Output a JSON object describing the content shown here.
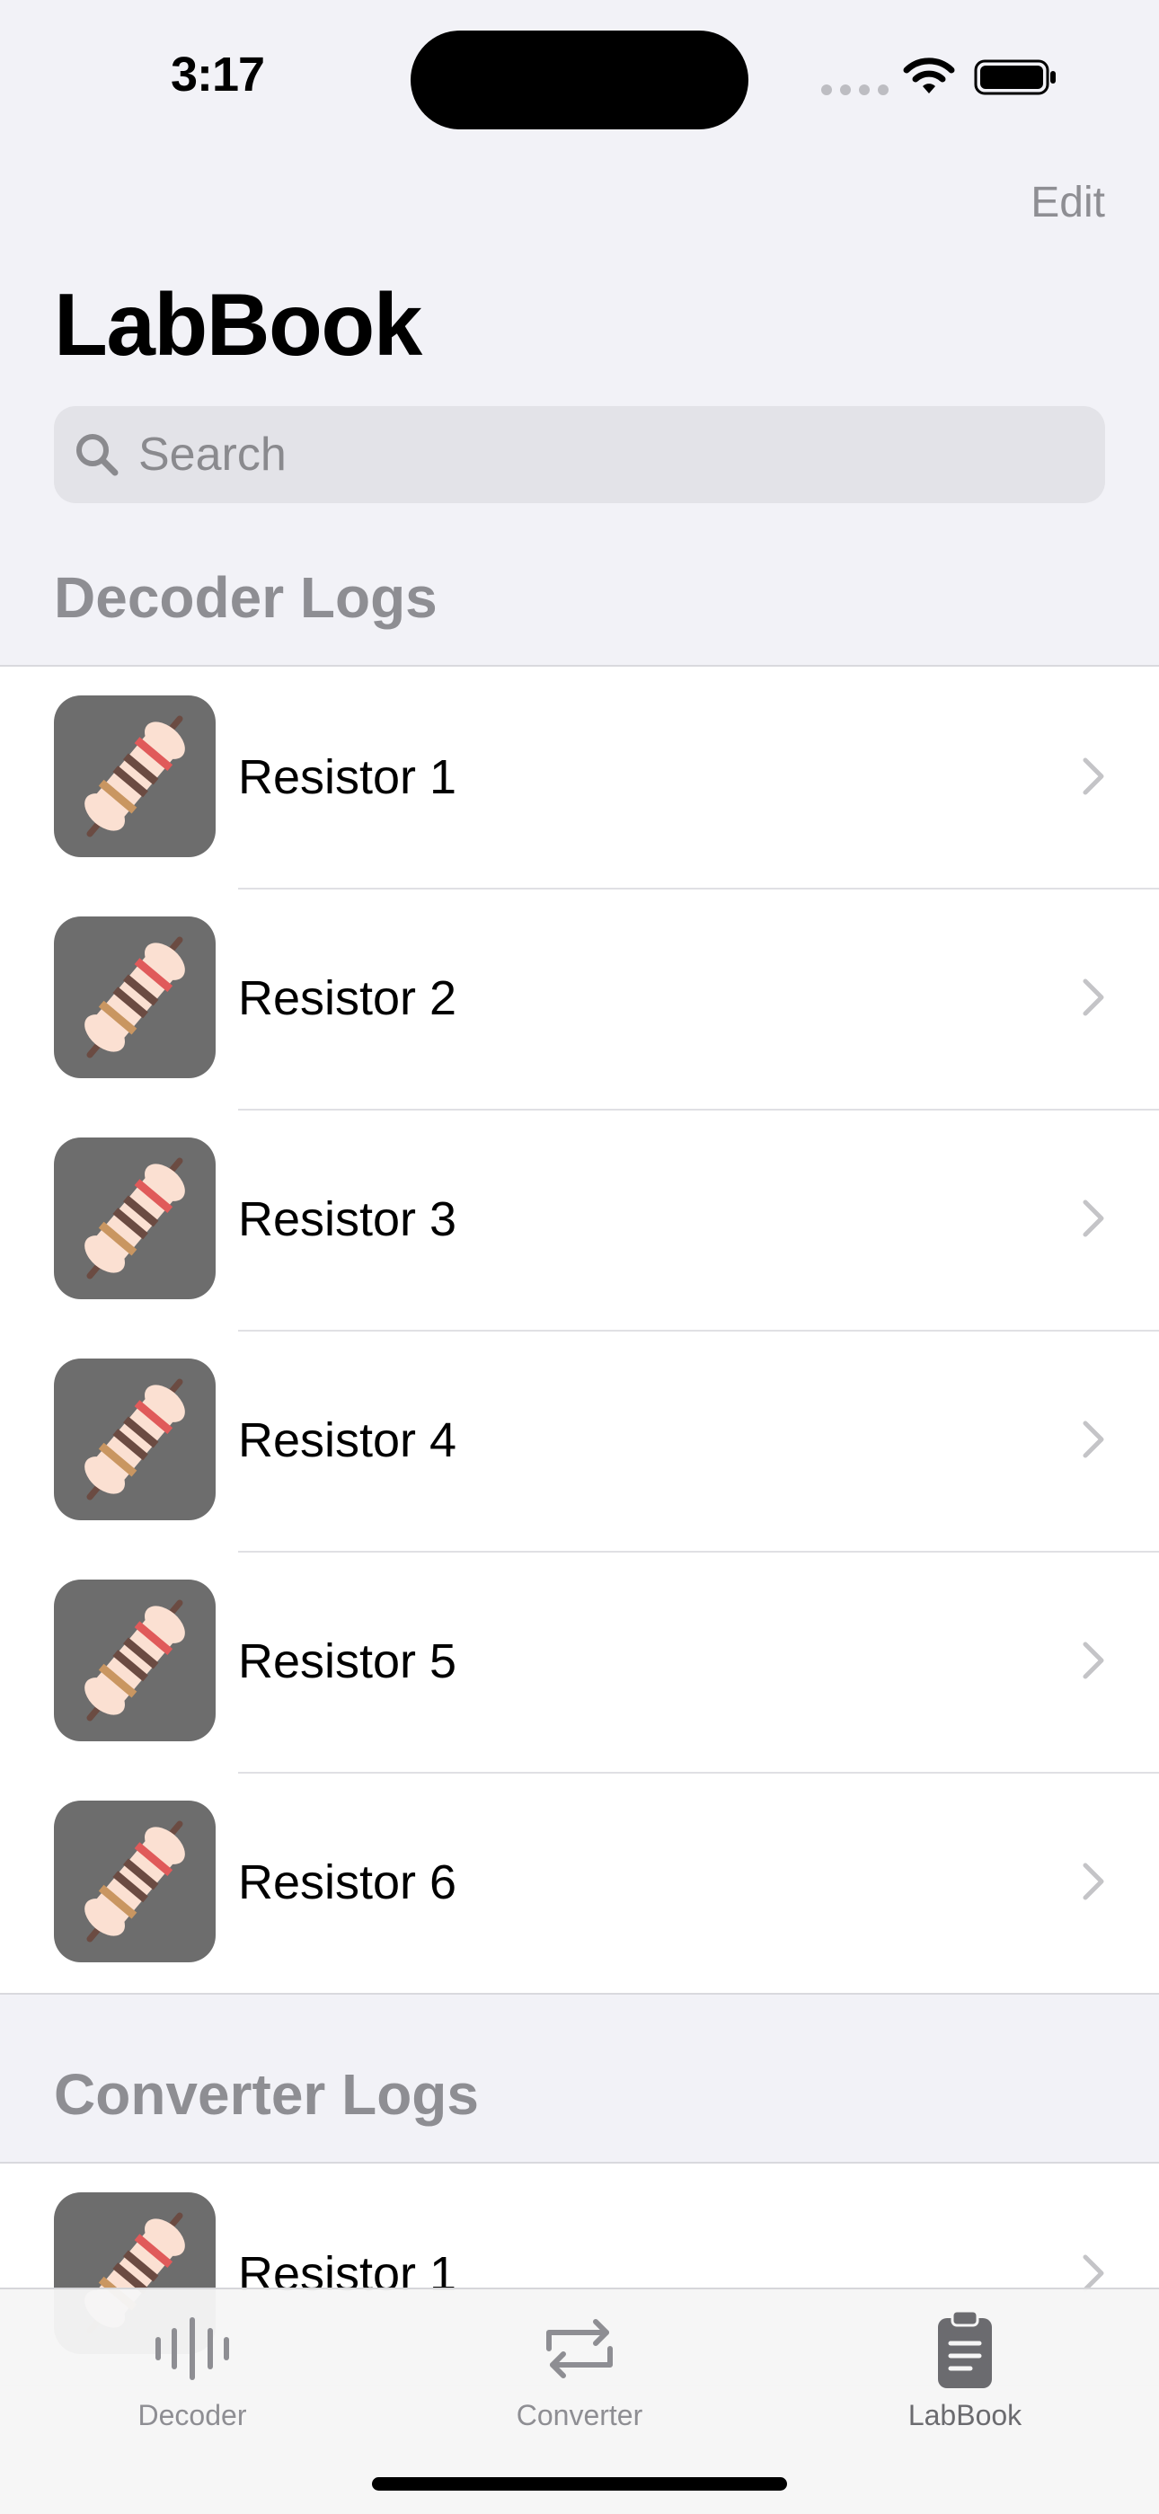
{
  "status_bar": {
    "time": "3:17"
  },
  "nav": {
    "edit_label": "Edit",
    "title": "LabBook"
  },
  "search": {
    "placeholder": "Search",
    "value": ""
  },
  "sections": {
    "decoder": {
      "header": "Decoder Logs",
      "items": [
        {
          "label": "Resistor 1",
          "icon": "resistor-icon"
        },
        {
          "label": "Resistor 2",
          "icon": "resistor-icon"
        },
        {
          "label": "Resistor 3",
          "icon": "resistor-icon"
        },
        {
          "label": "Resistor 4",
          "icon": "resistor-icon"
        },
        {
          "label": "Resistor 5",
          "icon": "resistor-icon"
        },
        {
          "label": "Resistor 6",
          "icon": "resistor-icon"
        }
      ]
    },
    "converter": {
      "header": "Converter Logs",
      "items": [
        {
          "label": "Resistor 1",
          "icon": "resistor-icon"
        }
      ]
    }
  },
  "tab_bar": {
    "tabs": [
      {
        "label": "Decoder",
        "icon": "waveform-icon",
        "active": false
      },
      {
        "label": "Converter",
        "icon": "convert-arrows-icon",
        "active": false
      },
      {
        "label": "LabBook",
        "icon": "clipboard-icon",
        "active": true
      }
    ]
  },
  "colors": {
    "background": "#f2f2f7",
    "secondary_text": "#8e8e93",
    "thumb_background": "#6d6d6d",
    "resistor_body": "#fbe0d2",
    "band_red": "#e05a5a",
    "band_brown": "#6b4b42",
    "band_gold": "#c99661"
  }
}
